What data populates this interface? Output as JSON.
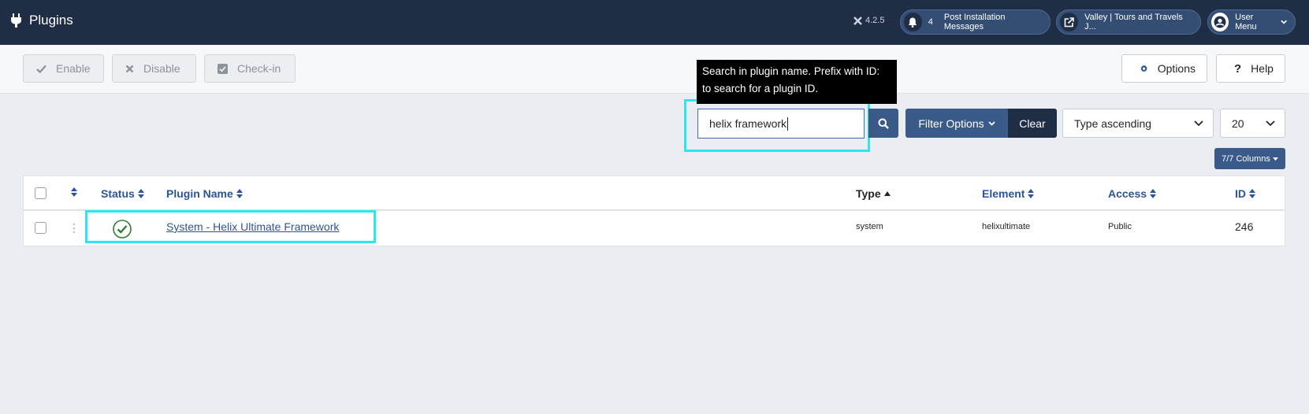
{
  "header": {
    "title": "Plugins",
    "version": "4.2.5",
    "notifications": {
      "count": "4",
      "label": "Post Installation Messages"
    },
    "site_link": "Valley | Tours and Travels J...",
    "user_menu": "User Menu"
  },
  "toolbar": {
    "enable_label": "Enable",
    "disable_label": "Disable",
    "checkin_label": "Check-in",
    "options_label": "Options",
    "help_label": "Help"
  },
  "search": {
    "value": "helix framework",
    "tooltip": "Search in plugin name. Prefix with ID: to search for a plugin ID."
  },
  "filters": {
    "filter_options_label": "Filter Options",
    "clear_label": "Clear",
    "ordering": "Type ascending",
    "limit": "20",
    "columns": "7/7 Columns"
  },
  "table": {
    "headers": {
      "status": "Status",
      "plugin_name": "Plugin Name",
      "type": "Type",
      "element": "Element",
      "access": "Access",
      "id": "ID"
    },
    "rows": [
      {
        "plugin_name": "System - Helix Ultimate Framework",
        "type": "system",
        "element": "helixultimate",
        "access": "Public",
        "id": "246",
        "status": "enabled"
      }
    ]
  },
  "colors": {
    "header_bg": "#1f2d45",
    "accent": "#3a5a8a",
    "link": "#2a5597",
    "status_ok": "#2f7d32",
    "highlight": "#2ee6ee"
  }
}
